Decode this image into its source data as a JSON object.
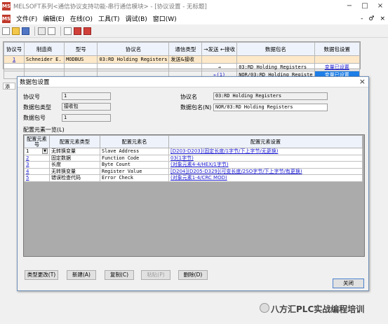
{
  "window": {
    "title": "MELSOFT系列<通信协议支持功能-串行通信模块> - [协议设置 - 无标题]",
    "app_icon": "MS",
    "controls": [
      "−",
      "□",
      "×"
    ]
  },
  "menubar": {
    "items": [
      "文件(F)",
      "编辑(E)",
      "在线(O)",
      "工具(T)",
      "调试(B)",
      "窗口(W)"
    ],
    "right": [
      "-",
      "♂",
      "×"
    ]
  },
  "toolbar": {
    "icons": [
      "new-file-icon",
      "open-folder-icon",
      "save-icon",
      "copy-icon",
      "paste-icon",
      "print-icon",
      "write-plc-icon",
      "read-plc-icon"
    ]
  },
  "protocol_table": {
    "headers": [
      "协议号",
      "制造商",
      "型号",
      "协议名",
      "通信类型",
      "→发送 ←接收",
      "数据包名",
      "数据包设置"
    ],
    "rows": [
      {
        "no": "1",
        "maker": "Schneider E.",
        "model": "MODBUS",
        "protocol": "03:RD Holding Registers",
        "comm_type": "发送&接收",
        "dir": "",
        "packet": "",
        "setting": ""
      },
      {
        "no": "",
        "maker": "",
        "model": "",
        "protocol": "",
        "comm_type": "",
        "dir": "→",
        "packet": "03:RD Holding Registers",
        "setting": "变量已设置"
      },
      {
        "no": "",
        "maker": "",
        "model": "",
        "protocol": "",
        "comm_type": "",
        "dir": "←(1)",
        "packet": "NOR/03:RD Holding Registe",
        "setting": "变量已设置"
      }
    ],
    "side_label": "添"
  },
  "dialog": {
    "title": "数据包设置",
    "close": "×",
    "protocol_no_label": "协议号",
    "protocol_no": "1",
    "packet_type_label": "数据包类型",
    "packet_type": "接收包",
    "packet_no_label": "数据包号",
    "packet_no": "1",
    "protocol_name_label": "协议名",
    "protocol_name": "03:RD Holding Registers",
    "packet_name_label": "数据包名(N)",
    "packet_name": "NOR/03:RD Holding Registers",
    "element_list_label": "配置元素一览(L)",
    "element_headers": [
      "配置元素号",
      "配置元素类型",
      "配置元素名",
      "配置元素设置"
    ],
    "elements": [
      {
        "no": "1",
        "type": "无转换变量",
        "name": "Slave Address",
        "setting": "[D203-D203](固定长度/1字节/下上字节/无更换)"
      },
      {
        "no": "2",
        "type": "固定数据",
        "name": "Function Code",
        "setting": "03(1字节)"
      },
      {
        "no": "3",
        "type": "长度",
        "name": "Byte Count",
        "setting": "(对象元素4-4/HEX/1字节)"
      },
      {
        "no": "4",
        "type": "无转换变量",
        "name": "Register Value",
        "setting": "[D204](D205-D329](可变长度/2SO字节/下上字节/有更换)"
      },
      {
        "no": "5",
        "type": "错误检查代码",
        "name": "Error Check",
        "setting": "(对象元素1-4/CRC MOD)"
      }
    ],
    "buttons": {
      "change_type": "类型更改(T)",
      "add": "新建(A)",
      "copy": "复制(C)",
      "paste": "粘贴(P)",
      "delete": "删除(D)",
      "close": "关闭"
    }
  },
  "watermark": "八方汇PLC实战编程培训"
}
